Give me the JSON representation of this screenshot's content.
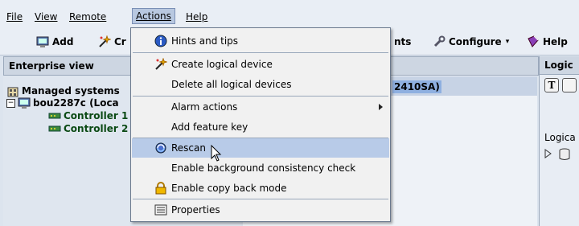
{
  "menubar": {
    "items": [
      {
        "label": "File"
      },
      {
        "label": "View"
      },
      {
        "label": "Remote"
      },
      {
        "label": "Actions"
      },
      {
        "label": "Help"
      }
    ]
  },
  "toolbar": {
    "add_label": "Add",
    "partial_label": "Cr",
    "events_label": "nts",
    "configure_label": "Configure",
    "help_label": "Help"
  },
  "left_panel": {
    "header": "Enterprise view",
    "tree": [
      {
        "label": "Managed systems"
      },
      {
        "label": "bou2287c (Loca"
      },
      {
        "label": "Controller 1"
      },
      {
        "label": "Controller 2"
      }
    ]
  },
  "center_panel": {
    "selected_text": "2410SA)"
  },
  "right_panel": {
    "header": "Logic",
    "text": "Logica",
    "buttons": [
      "T"
    ]
  },
  "actions_menu": {
    "items": [
      {
        "label": "Hints and tips",
        "icon": "info-icon"
      },
      {
        "label": "Create logical device",
        "icon": "wand-icon"
      },
      {
        "label": "Delete all logical devices",
        "icon": ""
      },
      {
        "label": "Alarm actions",
        "icon": "",
        "submenu": true
      },
      {
        "label": "Add feature key",
        "icon": ""
      },
      {
        "label": "Rescan",
        "icon": "rescan-icon"
      },
      {
        "label": "Enable background consistency check",
        "icon": ""
      },
      {
        "label": "Enable copy back mode",
        "icon": "lock-icon"
      },
      {
        "label": "Properties",
        "icon": "properties-icon"
      }
    ]
  },
  "colors": {
    "menu_hover": "#b8cbe8",
    "selection": "#8fb0e0",
    "panel_header": "#cdd6e2"
  }
}
